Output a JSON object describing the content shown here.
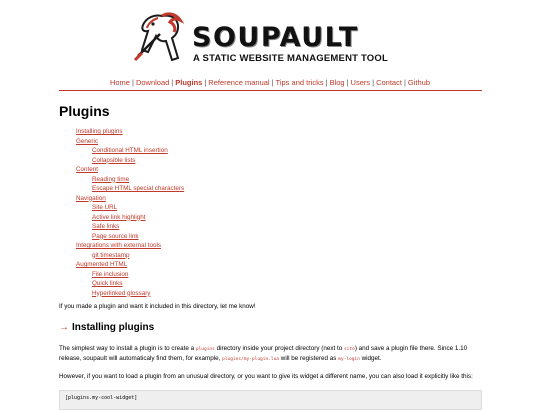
{
  "header": {
    "logo_title": "SOUPAULT",
    "logo_subtitle": "A STATIC WEBSITE MANAGEMENT TOOL"
  },
  "nav": {
    "items": [
      {
        "label": "Home"
      },
      {
        "label": "Download"
      },
      {
        "label": "Plugins",
        "active": true
      },
      {
        "label": "Reference manual"
      },
      {
        "label": "Tips and tricks"
      },
      {
        "label": "Blog"
      },
      {
        "label": "Users"
      },
      {
        "label": "Contact"
      },
      {
        "label": "Github"
      }
    ],
    "separator": "|"
  },
  "page": {
    "title": "Plugins",
    "toc": [
      {
        "label": "Installing plugins",
        "children": []
      },
      {
        "label": "Generic",
        "children": [
          "Conditional HTML insertion",
          "Collapsible lists"
        ]
      },
      {
        "label": "Content",
        "children": [
          "Reading time",
          "Escape HTML special characters"
        ]
      },
      {
        "label": "Navigation",
        "children": [
          "Site URL",
          "Active link highlight",
          "Safe links",
          "Page source link"
        ]
      },
      {
        "label": "Integrations with external tools",
        "children": [
          "git timestamp"
        ]
      },
      {
        "label": "Augmented HTML",
        "children": [
          "File inclusion",
          "Quick links",
          "Hyperlinked glossary"
        ]
      }
    ],
    "intro": "If you made a plugin and want it included in this directory, let me know!",
    "section_arrow": "→",
    "section_title": "Installing plugins",
    "para1": {
      "t1": "The simplest way to install a plugin is to create a ",
      "c1": "plugins",
      "t2": " directory inside your project directory (next to ",
      "c2": "site",
      "t3": ") and save a plugin file there. Since 1.10 release, soupault will automaticaly find them, for example, ",
      "c3": "plugins/my-plugin.lua",
      "t4": " will be registered as ",
      "c4": "my-login",
      "t5": " widget."
    },
    "para2": "However, if you want to load a plugin from an unusual directory, or you want to give its widget a different name, you can also load it explicitly like this:",
    "code": "[plugins.my-cool-widget]"
  }
}
